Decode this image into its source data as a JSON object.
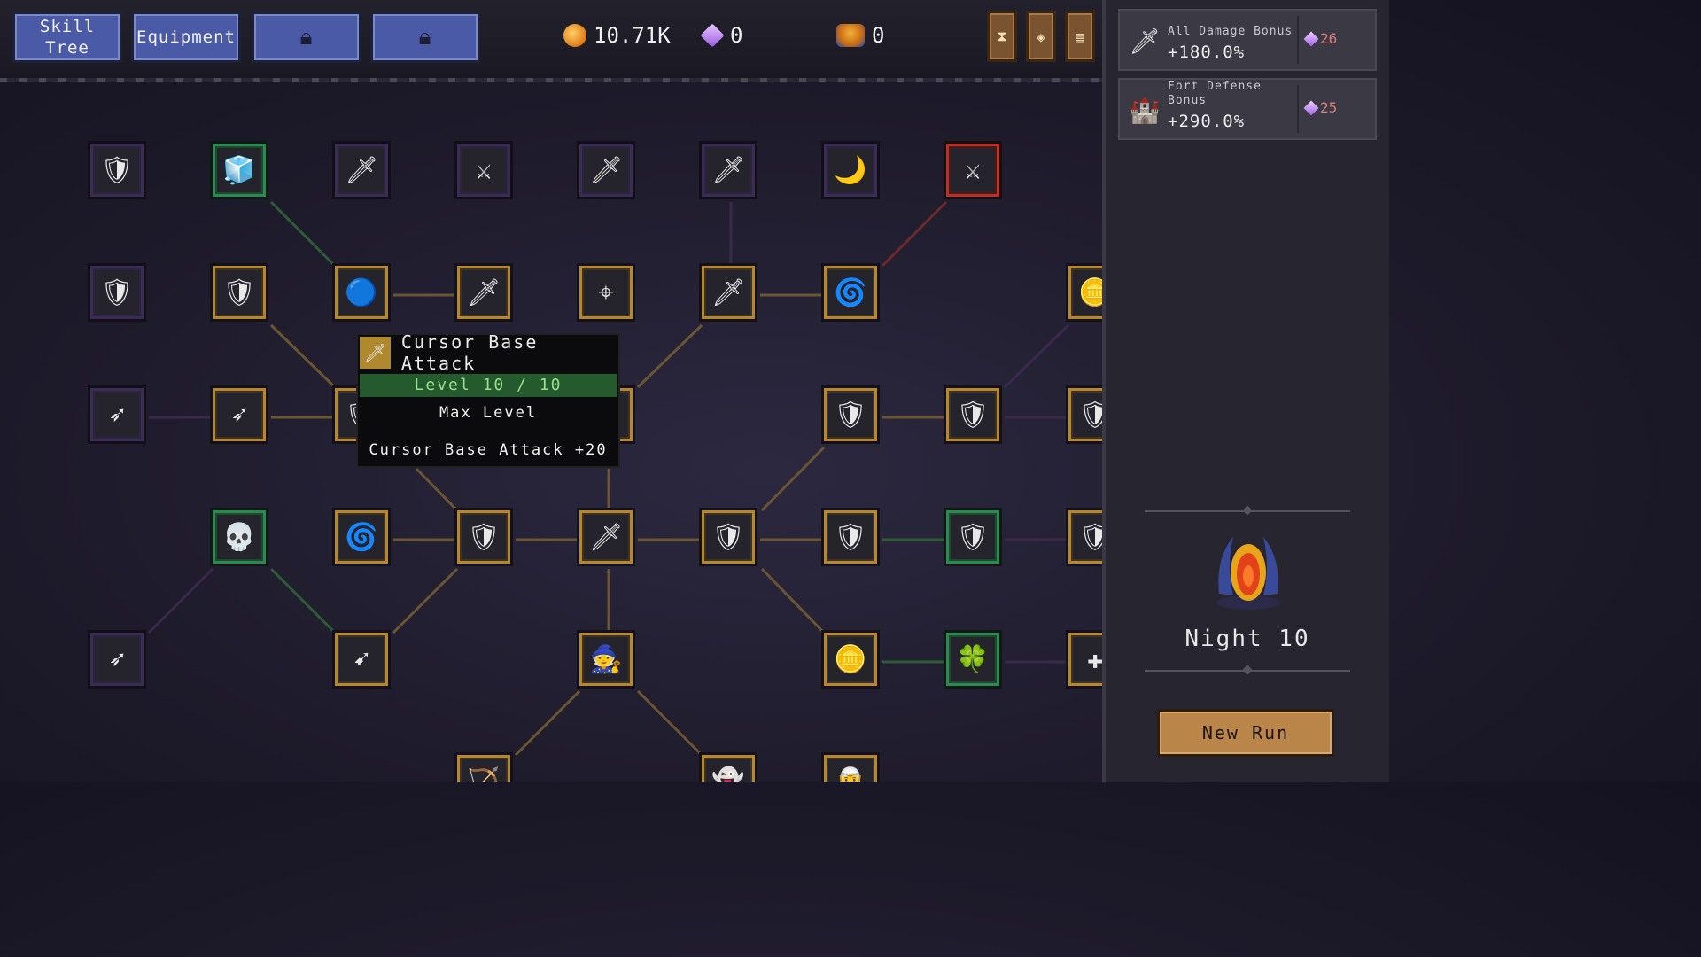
{
  "tabs": [
    {
      "label": "Skill\nTree",
      "state": "active"
    },
    {
      "label": "Equipment",
      "state": "normal"
    },
    {
      "label": "",
      "icon": "lock-icon",
      "state": "locked"
    },
    {
      "label": "",
      "icon": "lock-icon",
      "state": "locked"
    }
  ],
  "resources": {
    "gold": "10.71K",
    "gems": "0",
    "chests": "0"
  },
  "tooltip": {
    "title": "Cursor Base Attack",
    "level": "Level 10 / 10",
    "status": "Max Level",
    "effect": "Cursor Base Attack +20"
  },
  "bonuses": [
    {
      "name": "All Damage Bonus",
      "value": "+180.0%",
      "cost": "26",
      "icon": "sword-up-icon"
    },
    {
      "name": "Fort Defense Bonus",
      "value": "+290.0%",
      "cost": "25",
      "icon": "fort-up-icon"
    }
  ],
  "night_label": "Night 10",
  "new_run_label": "New Run",
  "colors": {
    "tab_blue": "#4b5aa6",
    "node_gold": "#b8862c",
    "node_green": "#2a8a52",
    "node_red": "#b83228",
    "node_locked": "#3b2c55",
    "button_bronze": "#b98548",
    "level_green": "#245a2e"
  },
  "nodes": [
    {
      "id": "n0",
      "icon": "archer-shield-icon",
      "glyph": "🛡",
      "state": "locked"
    },
    {
      "id": "n1",
      "icon": "ice-golem-icon",
      "glyph": "🧊",
      "state": "green"
    },
    {
      "id": "n2",
      "icon": "sword-icon",
      "glyph": "🗡",
      "state": "locked"
    },
    {
      "id": "n3",
      "icon": "crossed-swords-icon",
      "glyph": "⚔",
      "state": "locked"
    },
    {
      "id": "n4",
      "icon": "ice-sword-icon",
      "glyph": "🗡",
      "state": "locked"
    },
    {
      "id": "n5",
      "icon": "sword-up-icon",
      "glyph": "🗡",
      "state": "locked"
    },
    {
      "id": "n6",
      "icon": "crescent-blade-icon",
      "glyph": "🌙",
      "state": "locked"
    },
    {
      "id": "n7",
      "icon": "crossed-swords-icon",
      "glyph": "⚔",
      "state": "red"
    },
    {
      "id": "n8",
      "icon": "archer-shield-icon",
      "glyph": "🛡",
      "state": "locked"
    },
    {
      "id": "n9",
      "icon": "archer-shield-icon",
      "glyph": "🛡",
      "state": "gold"
    },
    {
      "id": "n10",
      "icon": "potion-icon",
      "glyph": "🔵",
      "state": "gold"
    },
    {
      "id": "n11",
      "icon": "sword-icon",
      "glyph": "🗡",
      "state": "gold"
    },
    {
      "id": "n12",
      "icon": "crosshair-icon",
      "glyph": "⌖",
      "state": "gold"
    },
    {
      "id": "n13",
      "icon": "sword-up-icon",
      "glyph": "🗡",
      "state": "gold"
    },
    {
      "id": "n14",
      "icon": "whirlwind-icon",
      "glyph": "🌀",
      "state": "gold"
    },
    {
      "id": "n15",
      "icon": "gold-coin-icon",
      "glyph": "🪙",
      "state": "gold"
    },
    {
      "id": "n16",
      "icon": "spear-icon",
      "glyph": "➶",
      "state": "locked"
    },
    {
      "id": "n17",
      "icon": "spear-icon",
      "glyph": "➶",
      "state": "gold"
    },
    {
      "id": "n18",
      "icon": "archer-shield-icon",
      "glyph": "🛡",
      "state": "gold"
    },
    {
      "id": "n19",
      "icon": "ice-sword-icon",
      "glyph": "🗡",
      "state": "gold"
    },
    {
      "id": "n20",
      "icon": "shield-up-icon",
      "glyph": "🛡",
      "state": "gold"
    },
    {
      "id": "n21",
      "icon": "shield-up-icon",
      "glyph": "🛡",
      "state": "gold"
    },
    {
      "id": "n22",
      "icon": "shield-icon",
      "glyph": "🛡",
      "state": "gold"
    },
    {
      "id": "n23",
      "icon": "skull-icon",
      "glyph": "💀",
      "state": "green"
    },
    {
      "id": "n24",
      "icon": "swirl-arrow-icon",
      "glyph": "🌀",
      "state": "gold"
    },
    {
      "id": "n25",
      "icon": "archer-shield-icon",
      "glyph": "🛡",
      "state": "gold"
    },
    {
      "id": "n26",
      "icon": "sword-icon",
      "glyph": "🗡",
      "state": "gold"
    },
    {
      "id": "n27",
      "icon": "shield-icon",
      "glyph": "🛡",
      "state": "gold"
    },
    {
      "id": "n28",
      "icon": "shield-icon",
      "glyph": "🛡",
      "state": "gold"
    },
    {
      "id": "n29",
      "icon": "shield-icon",
      "glyph": "🛡",
      "state": "green"
    },
    {
      "id": "n30",
      "icon": "shield-icon",
      "glyph": "🛡",
      "state": "gold"
    },
    {
      "id": "n31",
      "icon": "ice-arrow-icon",
      "glyph": "➶",
      "state": "locked"
    },
    {
      "id": "n32",
      "icon": "arrow-icon",
      "glyph": "➹",
      "state": "gold"
    },
    {
      "id": "n33",
      "icon": "wizard-icon",
      "glyph": "🧙",
      "state": "gold"
    },
    {
      "id": "n34",
      "icon": "gold-coin-icon",
      "glyph": "🪙",
      "state": "gold"
    },
    {
      "id": "n35",
      "icon": "clover-icon",
      "glyph": "🍀",
      "state": "green"
    },
    {
      "id": "n36",
      "icon": "plus-icon",
      "glyph": "✚",
      "state": "gold"
    },
    {
      "id": "n37",
      "icon": "archer-icon",
      "glyph": "🏹",
      "state": "gold"
    },
    {
      "id": "n38",
      "icon": "ghost-icon",
      "glyph": "👻",
      "state": "gold"
    },
    {
      "id": "n39",
      "icon": "mage-icon",
      "glyph": "🧝",
      "state": "gold"
    }
  ]
}
